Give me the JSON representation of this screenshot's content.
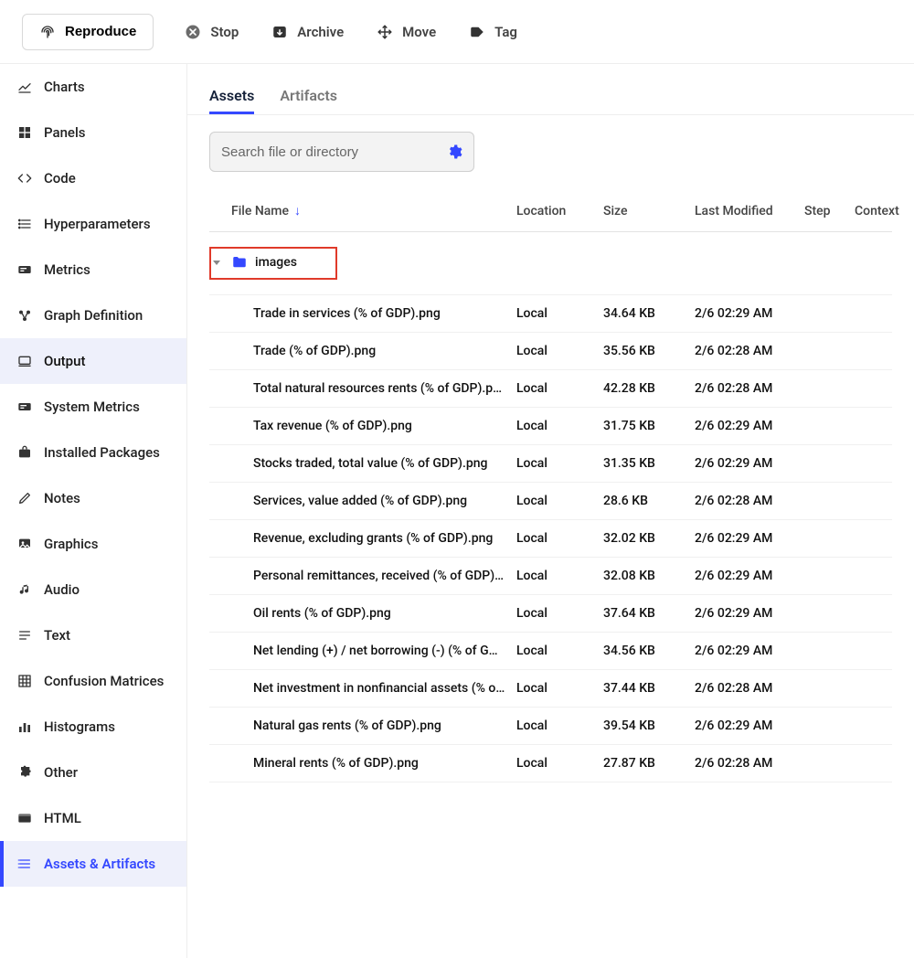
{
  "toolbar": {
    "reproduce_label": "Reproduce",
    "stop_label": "Stop",
    "archive_label": "Archive",
    "move_label": "Move",
    "tag_label": "Tag"
  },
  "sidebar": {
    "items": [
      {
        "label": "Charts",
        "icon": "charts-icon",
        "state": "default"
      },
      {
        "label": "Panels",
        "icon": "panels-icon",
        "state": "default"
      },
      {
        "label": "Code",
        "icon": "code-icon",
        "state": "default"
      },
      {
        "label": "Hyperparameters",
        "icon": "list-icon",
        "state": "default"
      },
      {
        "label": "Metrics",
        "icon": "metrics-icon",
        "state": "default"
      },
      {
        "label": "Graph Definition",
        "icon": "graph-icon",
        "state": "default"
      },
      {
        "label": "Output",
        "icon": "output-icon",
        "state": "selected"
      },
      {
        "label": "System Metrics",
        "icon": "metrics-icon",
        "state": "default"
      },
      {
        "label": "Installed Packages",
        "icon": "packages-icon",
        "state": "default"
      },
      {
        "label": "Notes",
        "icon": "notes-icon",
        "state": "default"
      },
      {
        "label": "Graphics",
        "icon": "graphics-icon",
        "state": "default"
      },
      {
        "label": "Audio",
        "icon": "audio-icon",
        "state": "default"
      },
      {
        "label": "Text",
        "icon": "text-icon",
        "state": "default"
      },
      {
        "label": "Confusion Matrices",
        "icon": "matrix-icon",
        "state": "default"
      },
      {
        "label": "Histograms",
        "icon": "histogram-icon",
        "state": "default"
      },
      {
        "label": "Other",
        "icon": "puzzle-icon",
        "state": "default"
      },
      {
        "label": "HTML",
        "icon": "html-icon",
        "state": "default"
      },
      {
        "label": "Assets & Artifacts",
        "icon": "assets-icon",
        "state": "active"
      }
    ]
  },
  "tabs": [
    {
      "label": "Assets",
      "active": true
    },
    {
      "label": "Artifacts",
      "active": false
    }
  ],
  "search": {
    "placeholder": "Search file or directory"
  },
  "table": {
    "columns": [
      "File Name",
      "Location",
      "Size",
      "Last Modified",
      "Step",
      "Context"
    ],
    "sort_column": 0,
    "sort_dir": "↓",
    "folder": {
      "name": "images",
      "highlighted": true
    },
    "rows": [
      {
        "name": "Trade in services (% of GDP).png",
        "location": "Local",
        "size": "34.64 KB",
        "modified": "2/6 02:29 AM"
      },
      {
        "name": "Trade (% of GDP).png",
        "location": "Local",
        "size": "35.56 KB",
        "modified": "2/6 02:28 AM"
      },
      {
        "name": "Total natural resources rents (% of GDP).png",
        "location": "Local",
        "size": "42.28 KB",
        "modified": "2/6 02:28 AM"
      },
      {
        "name": "Tax revenue (% of GDP).png",
        "location": "Local",
        "size": "31.75 KB",
        "modified": "2/6 02:29 AM"
      },
      {
        "name": "Stocks traded, total value (% of GDP).png",
        "location": "Local",
        "size": "31.35 KB",
        "modified": "2/6 02:29 AM"
      },
      {
        "name": "Services, value added (% of GDP).png",
        "location": "Local",
        "size": "28.6 KB",
        "modified": "2/6 02:28 AM"
      },
      {
        "name": "Revenue, excluding grants (% of GDP).png",
        "location": "Local",
        "size": "32.02 KB",
        "modified": "2/6 02:29 AM"
      },
      {
        "name": "Personal remittances, received (% of GDP).p…",
        "location": "Local",
        "size": "32.08 KB",
        "modified": "2/6 02:29 AM"
      },
      {
        "name": "Oil rents (% of GDP).png",
        "location": "Local",
        "size": "37.64 KB",
        "modified": "2/6 02:29 AM"
      },
      {
        "name": "Net lending (+) / net borrowing (-) (% of GDP…",
        "location": "Local",
        "size": "34.56 KB",
        "modified": "2/6 02:29 AM"
      },
      {
        "name": "Net investment in nonfinancial assets (% of …",
        "location": "Local",
        "size": "37.44 KB",
        "modified": "2/6 02:28 AM"
      },
      {
        "name": "Natural gas rents (% of GDP).png",
        "location": "Local",
        "size": "39.54 KB",
        "modified": "2/6 02:29 AM"
      },
      {
        "name": "Mineral rents (% of GDP).png",
        "location": "Local",
        "size": "27.87 KB",
        "modified": "2/6 02:28 AM"
      }
    ]
  }
}
